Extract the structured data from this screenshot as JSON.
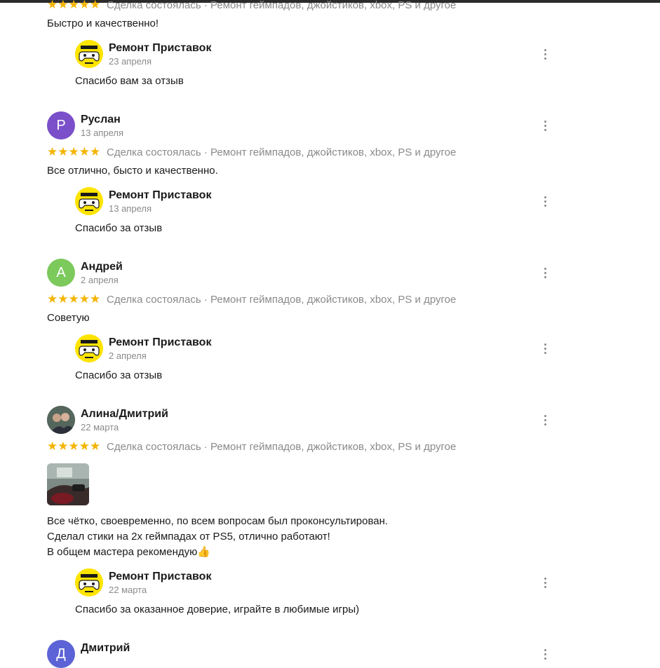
{
  "shop_name": "Ремонт Приставок",
  "meta_line": "Сделка состоялась · Ремонт геймпадов, джойстиков, xbox, PS и другое",
  "stars": "★★★★★",
  "colors": {
    "star": "#f4b400",
    "logo_bg": "#ffe400",
    "avatar_ruslan": "#7a4fc9",
    "avatar_andrey": "#7cc95c",
    "avatar_dmitry": "#5c63d6"
  },
  "review0": {
    "text": "Быстро и качественно!",
    "reply_date": "23 апреля",
    "reply_text": "Спасибо вам за отзыв"
  },
  "review1": {
    "initial": "Р",
    "author": "Руслан",
    "date": "13 апреля",
    "text": "Все отлично, бысто и качественно.",
    "reply_date": "13 апреля",
    "reply_text": "Спасибо за отзыв"
  },
  "review2": {
    "initial": "А",
    "author": "Андрей",
    "date": "2 апреля",
    "text": "Советую",
    "reply_date": "2 апреля",
    "reply_text": "Спасибо за отзыв"
  },
  "review3": {
    "author": "Алина/Дмитрий",
    "date": "22 марта",
    "text_lines": [
      "Все чётко, своевременно, по всем вопросам был проконсультирован.",
      "Сделал стики на 2х геймпадах от PS5, отлично работают!",
      "В общем мастера рекомендую"
    ],
    "emoji": "👍",
    "reply_date": "22 марта",
    "reply_text": "Спасибо за оказанное доверие, играйте в любимые игры)"
  },
  "review4": {
    "initial": "Д",
    "author": "Дмитрий"
  },
  "icons": {
    "more": "more-vertical-icon",
    "star": "star-icon",
    "logo": "gamepad-logo-icon"
  }
}
